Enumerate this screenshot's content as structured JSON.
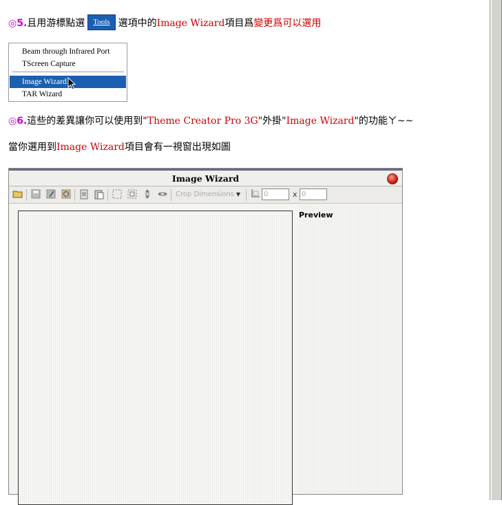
{
  "step5": {
    "marker": "◎5.",
    "text1": "且用游標點選",
    "tools_label": "Tools",
    "text2": "選項中的",
    "item": "Image Wizard",
    "text3": "項目爲",
    "text4": "變更爲可以選用"
  },
  "menu": {
    "items": [
      {
        "label": "Beam through Infrared Port"
      },
      {
        "label": "TScreen Capture"
      },
      {
        "label": "Image Wizard"
      },
      {
        "label": "TAR Wizard"
      }
    ]
  },
  "step6": {
    "marker": "◎6.",
    "text1": "這些的差異讓你可以使用到\"",
    "app": "Theme Creator Pro 3G",
    "text2": "\"外掛\"",
    "item": "Image Wizard",
    "text3": "\"的功能ㄚ~~"
  },
  "line3": {
    "text1": "當你選用到",
    "item": "Image Wizard",
    "text2": "項目會有一視窗出現如圖"
  },
  "window": {
    "title": "Image Wizard",
    "crop_dropdown": "Crop Dimensions",
    "width_value": "0",
    "x_label": "x",
    "height_value": "0",
    "preview_label": "Preview"
  },
  "icons": [
    "open-folder-icon",
    "save-icon",
    "save-as-icon",
    "revert-icon",
    "copy-icon",
    "paste-icon",
    "crop-select-icon",
    "crop-fit-icon",
    "flip-vertical-icon",
    "flip-horizontal-icon",
    "crop-origin-icon",
    "close-icon",
    "cursor-arrow-icon"
  ],
  "colors": {
    "accent_red": "#cc0000",
    "marker": "#cc00cc",
    "selection": "#1c5fb0"
  }
}
